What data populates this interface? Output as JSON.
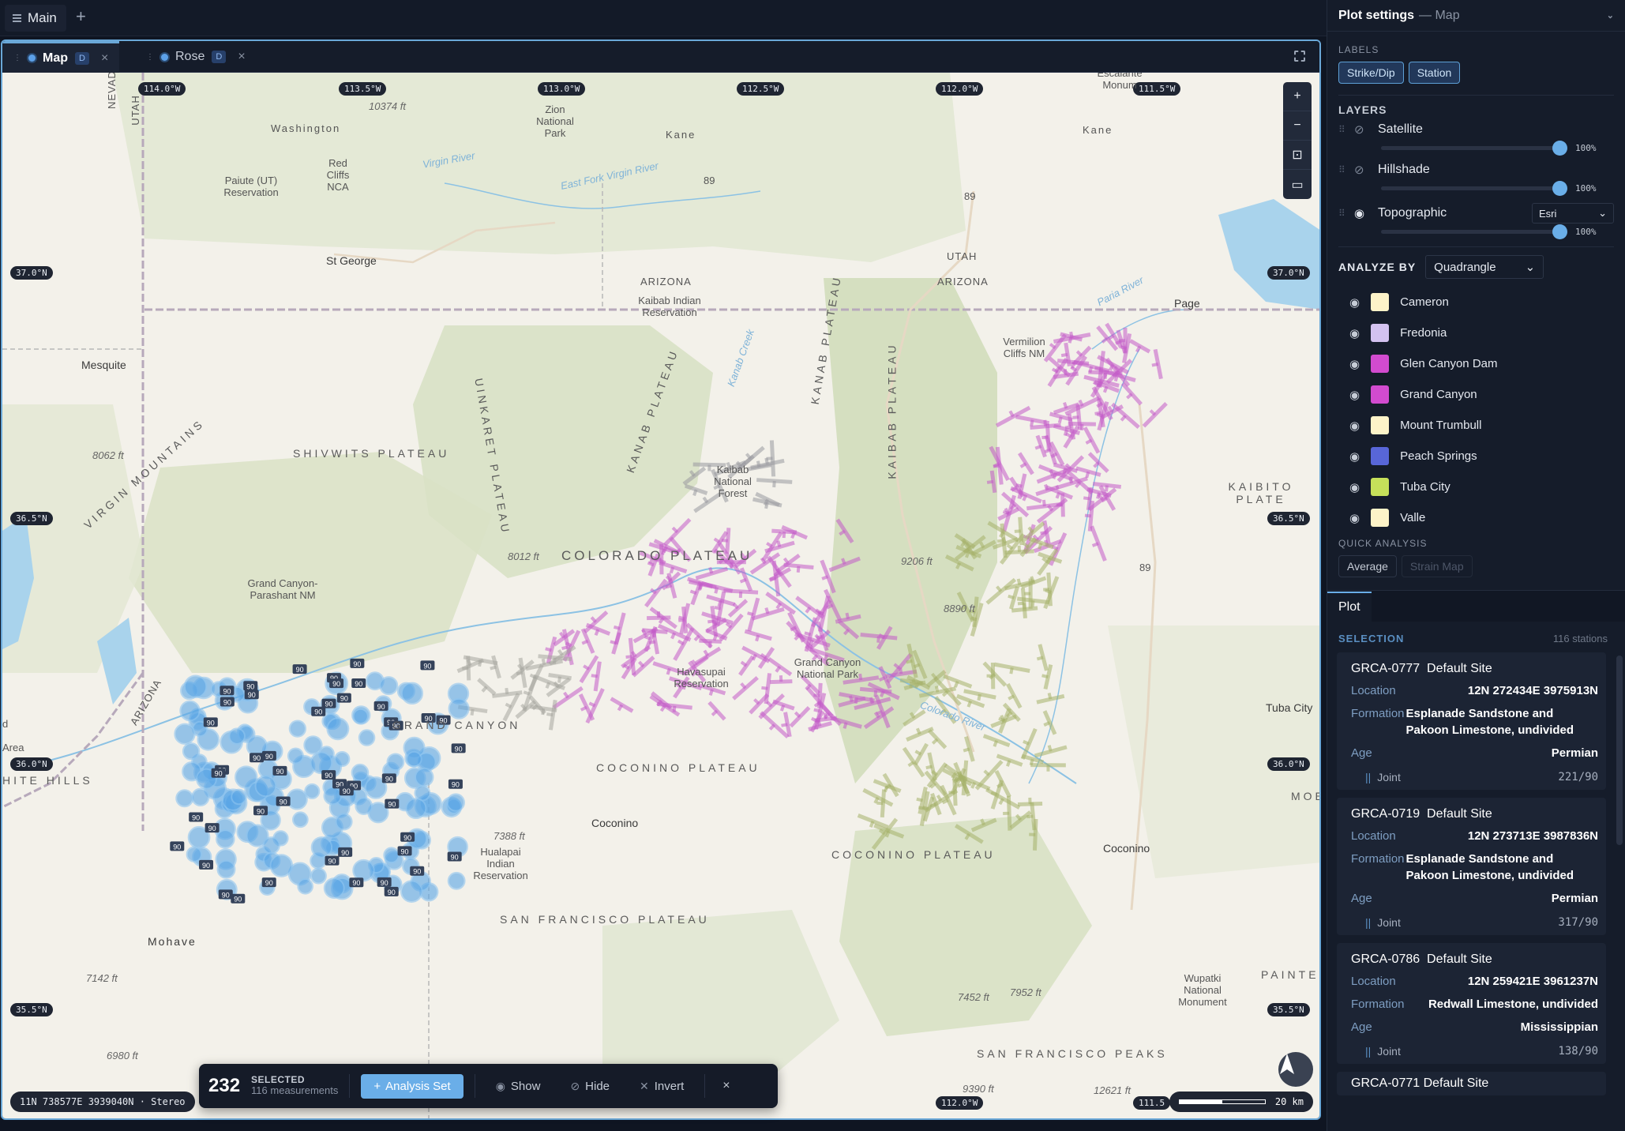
{
  "topbar": {
    "tab_label": "Main",
    "add_label": "+"
  },
  "map_tabs": [
    {
      "label": "Map",
      "badge": "D",
      "active": true
    },
    {
      "label": "Rose",
      "badge": "D",
      "active": false
    }
  ],
  "map": {
    "lon_labels": [
      "114.0°W",
      "113.5°W",
      "113.0°W",
      "112.5°W",
      "112.0°W",
      "111.5°W"
    ],
    "lat_labels": [
      "37.0°N",
      "36.5°N",
      "36.0°N",
      "35.5°N"
    ],
    "lat_labels_right": [
      "37.0°N",
      "36.5°N",
      "36.0°N",
      "35.5°N"
    ],
    "bottom_lon_labels": [
      "112.0°W",
      "111.5"
    ],
    "places": {
      "st_george": "St George",
      "washington": "Washington",
      "paiute": "Paiute (UT) Reservation",
      "red_cliffs": "Red Cliffs NCA",
      "zion": "Zion National Park",
      "kane1": "Kane",
      "kane2": "Kane",
      "escalante": "Escalante Monum",
      "utah1": "UTAH",
      "utah2": "UTAH",
      "nevada": "NEVADA",
      "arizona1": "ARIZONA",
      "arizona2": "ARIZONA",
      "arizona3": "ARIZONA",
      "kaibab_res": "Kaibab Indian Reservation",
      "page": "Page",
      "vermilion": "Vermilion Cliffs NM",
      "mesquite": "Mesquite",
      "virgin_mtns": "VIRGIN MOUNTAINS",
      "shivwits": "SHIVWITS PLATEAU",
      "uinkaret": "UINKARET PLATEAU",
      "kanab_plateau": "KANAB PLATEAU",
      "kanab_plat2": "KANAB PLATEAU",
      "kaibab_plateau": "KAIBAB PLATEAU",
      "kaibab_nf": "Kaibab National Forest",
      "colorado_plateau": "COLORADO PLATEAU",
      "kaibito": "KAIBITO PLATE",
      "grand_canyon_parashant": "Grand Canyon-Parashant NM",
      "havasupai": "Havasupai Reservation",
      "gc_np": "Grand Canyon National Park",
      "grand_canyon_region": "GRAND CANYON",
      "tuba_city": "Tuba City",
      "coconino_plateau1": "COCONINO PLATEAU",
      "coconino_plateau2": "COCONINO PLATEAU",
      "coconino1": "Coconino",
      "coconino2": "Coconino",
      "hualapai": "Hualapai Indian Reservation",
      "white_hills": "HITE HILLS",
      "moen": "MOEN",
      "san_francisco_plateau": "SAN FRANCISCO PLATEAU",
      "san_francisco_peaks": "SAN FRANCISCO PEAKS",
      "mohave": "Mohave",
      "painted": "PAINTED",
      "wupatki": "Wupatki National Monument",
      "area": "Area",
      "d": "d",
      "colorado_river": "Colorado River",
      "virgin_river": "Virgin River",
      "east_fork": "East Fork Virgin River",
      "paria_river": "Paria River",
      "kanab_creek": "Kanab Creek"
    },
    "elevations": [
      "10374 ft",
      "8062 ft",
      "8012 ft",
      "9206 ft",
      "8890 ft",
      "7388 ft",
      "7142 ft",
      "6980 ft",
      "7452 ft",
      "7952 ft",
      "9390 ft",
      "12621 ft"
    ],
    "road_labels": [
      "89",
      "89",
      "89"
    ],
    "cluster_badge": "90",
    "controls": [
      "+",
      "−",
      "⊡",
      "▭"
    ],
    "coord_readout": "11N 738577E 3939040N · Stereo",
    "scale_label": "20 km"
  },
  "selection_bar": {
    "count": "232",
    "label": "SELECTED",
    "measurements": "116 measurements",
    "analysis_set": "Analysis Set",
    "show": "Show",
    "hide": "Hide",
    "invert": "Invert",
    "close": "×"
  },
  "settings": {
    "title": "Plot settings",
    "subtitle": "— Map",
    "labels_section": "LABELS",
    "label_pills": [
      "Strike/Dip",
      "Station"
    ],
    "layers_section": "LAYERS",
    "layers": [
      {
        "name": "Satellite",
        "visible": false,
        "opacity_pct": 100,
        "pct_label": "100%"
      },
      {
        "name": "Hillshade",
        "visible": false,
        "opacity_pct": 100,
        "pct_label": "100%"
      },
      {
        "name": "Topographic",
        "visible": true,
        "opacity_pct": 100,
        "pct_label": "100%",
        "source": "Esri"
      }
    ],
    "analyze_label": "ANALYZE BY",
    "analyze_value": "Quadrangle",
    "quadrangles": [
      {
        "name": "Cameron",
        "color": "#fdf3c8"
      },
      {
        "name": "Fredonia",
        "color": "#d3c2f0"
      },
      {
        "name": "Glen Canyon Dam",
        "color": "#d24bcf"
      },
      {
        "name": "Grand Canyon",
        "color": "#d24bcf"
      },
      {
        "name": "Mount Trumbull",
        "color": "#fdf3c8"
      },
      {
        "name": "Peach Springs",
        "color": "#5866d8"
      },
      {
        "name": "Tuba City",
        "color": "#c6e05a"
      },
      {
        "name": "Valle",
        "color": "#fdf3c8"
      }
    ],
    "quick_label": "QUICK ANALYSIS",
    "quick_buttons": [
      "Average",
      "Strain Map"
    ]
  },
  "plot": {
    "tab": "Plot",
    "selection_label": "SELECTION",
    "station_count": "116 stations",
    "location_key": "Location",
    "formation_key": "Formation",
    "age_key": "Age",
    "stations": [
      {
        "id": "GRCA-0777",
        "site": "Default Site",
        "location": "12N 272434E 3975913N",
        "formation": "Esplanade Sandstone and Pakoon Limestone, undivided",
        "age": "Permian",
        "type": "Joint",
        "value": "221/90"
      },
      {
        "id": "GRCA-0719",
        "site": "Default Site",
        "location": "12N 273713E 3987836N",
        "formation": "Esplanade Sandstone and Pakoon Limestone, undivided",
        "age": "Permian",
        "type": "Joint",
        "value": "317/90"
      },
      {
        "id": "GRCA-0786",
        "site": "Default Site",
        "location": "12N 259421E 3961237N",
        "formation": "Redwall Limestone, undivided",
        "age": "Mississippian",
        "type": "Joint",
        "value": "138/90"
      }
    ],
    "next_station_id": "GRCA-0771 Default Site"
  },
  "colors": {
    "accent": "#6aaee8",
    "peach_springs_points": "#5aa6e6",
    "grand_canyon_points": "#c45cc9",
    "tuba_city_points": "#a6b26a"
  }
}
